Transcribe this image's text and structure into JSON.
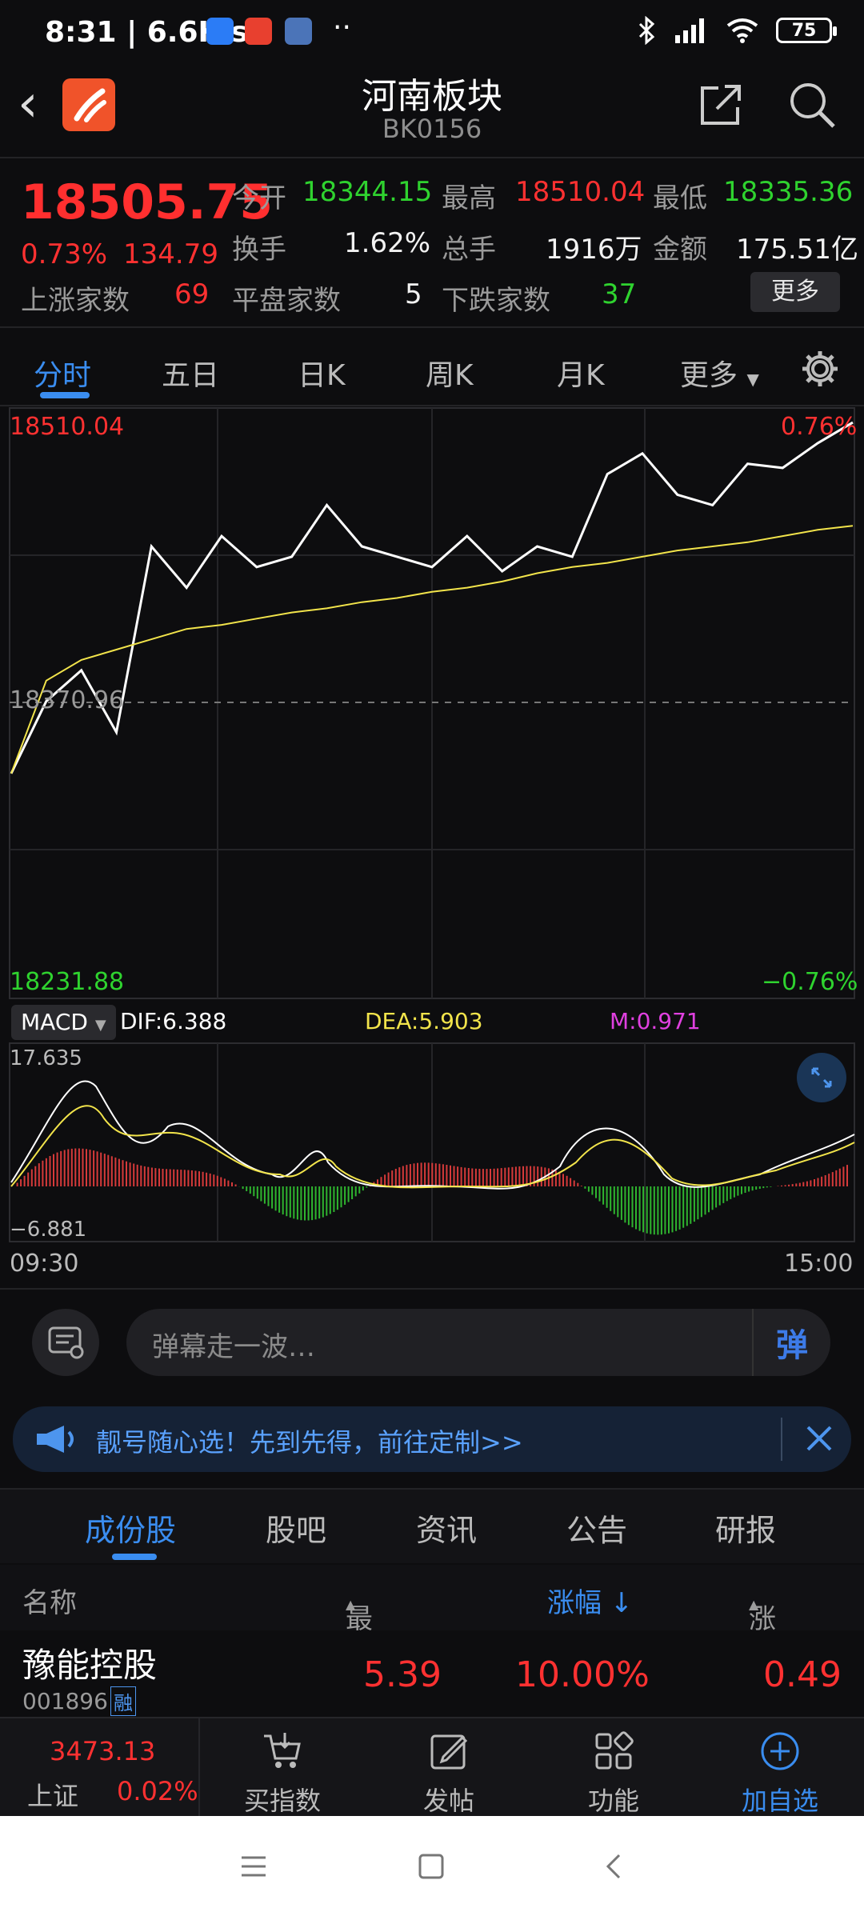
{
  "status_bar": {
    "time_net": "8:31 | 6.6K/s",
    "dots": "··",
    "battery": "75",
    "wifi_icon": "wifi-icon",
    "signal_icon": "signal-icon",
    "bluetooth_icon": "bluetooth-icon"
  },
  "header": {
    "title": "河南板块",
    "code": "BK0156"
  },
  "quote": {
    "price": "18505.75",
    "change_pct": "0.73%",
    "change_val": "134.79",
    "up_label": "上涨家数",
    "up_val": "69",
    "flat_label": "平盘家数",
    "flat_val": "5",
    "down_label": "下跌家数",
    "down_val": "37",
    "open_label": "今开",
    "open_val": "18344.15",
    "high_label": "最高",
    "high_val": "18510.04",
    "low_label": "最低",
    "low_val": "18335.36",
    "turnover_label": "换手",
    "turnover_val": "1.62%",
    "volume_label": "总手",
    "volume_val": "1916万",
    "amount_label": "金额",
    "amount_val": "175.51亿",
    "more_btn": "更多"
  },
  "chart_tabs": [
    "分时",
    "五日",
    "日K",
    "周K",
    "月K",
    "更多"
  ],
  "chart": {
    "top_left": "18510.04",
    "top_right": "0.76%",
    "mid_left": "18370.96",
    "bottom_left": "18231.88",
    "bottom_right": "−0.76%",
    "macd_btn": "MACD",
    "dif": "DIF:6.388",
    "dea": "DEA:5.903",
    "m": "M:0.971",
    "macd_top": "17.635",
    "macd_bottom": "−6.881",
    "time_start": "09:30",
    "time_end": "15:00"
  },
  "chart_data": {
    "type": "line",
    "x_range": [
      "09:30",
      "15:00"
    ],
    "ylim": [
      18231.88,
      18510.04
    ],
    "pct_range": [
      "-0.76%",
      "0.76%"
    ],
    "prev_close": 18370.96,
    "series": [
      {
        "values": [
          18340,
          18375,
          18390,
          18360,
          18450,
          18430,
          18455,
          18440,
          18445,
          18470,
          18450,
          18445,
          18440,
          18455,
          18438,
          18450,
          18445,
          18485,
          18495,
          18475,
          18470,
          18490,
          18488,
          18500,
          18510
        ]
      },
      {
        "values": [
          18340,
          18385,
          18395,
          18400,
          18405,
          18410,
          18412,
          18415,
          18418,
          18420,
          18423,
          18425,
          18428,
          18430,
          18433,
          18437,
          18440,
          18442,
          18445,
          18448,
          18450,
          18452,
          18455,
          18458,
          18460
        ]
      }
    ]
  },
  "danmaku": {
    "placeholder": "弹幕走一波…",
    "send": "弹"
  },
  "banner": {
    "text": "靓号随心选！先到先得，前往定制>>"
  },
  "sub_tabs": [
    "成份股",
    "股吧",
    "资讯",
    "公告",
    "研报"
  ],
  "table": {
    "headers": [
      "名称",
      "最新",
      "涨幅 ↓",
      "涨跌"
    ],
    "rows": [
      {
        "name": "豫能控股",
        "code": "001896",
        "tag": "融",
        "latest": "5.39",
        "pct": "10.00%",
        "chg": "0.49"
      }
    ]
  },
  "toolbar": {
    "index_val": "3473.13",
    "index_name": "上证",
    "index_pct": "0.02%",
    "items": [
      "买指数",
      "发帖",
      "功能",
      "加自选"
    ]
  }
}
